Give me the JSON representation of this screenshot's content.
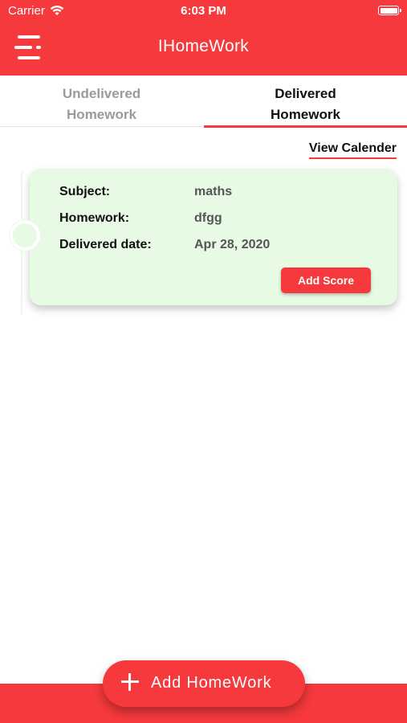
{
  "status_bar": {
    "carrier": "Carrier",
    "time": "6:03 PM",
    "wifi_icon": "wifi-icon",
    "battery_icon": "battery-icon"
  },
  "header": {
    "title": "IHomeWork",
    "menu_icon": "hamburger-menu-icon"
  },
  "colors": {
    "accent": "#f5393d",
    "card_bg": "#e7fbe4",
    "inactive_tab": "#9b9b9b"
  },
  "tabs": [
    {
      "line1": "Undelivered",
      "line2": "Homework",
      "selected": false
    },
    {
      "line1": "Delivered",
      "line2": "Homework",
      "selected": true
    }
  ],
  "view_calendar": "View Calender",
  "homework_card": {
    "subject_label": "Subject:",
    "subject_value": "maths",
    "homework_label": "Homework:",
    "homework_value": "dfgg",
    "date_label": "Delivered date:",
    "date_value": "Apr 28, 2020",
    "add_score": "Add Score"
  },
  "add_homework": {
    "label": "Add HomeWork",
    "icon": "plus-icon"
  }
}
